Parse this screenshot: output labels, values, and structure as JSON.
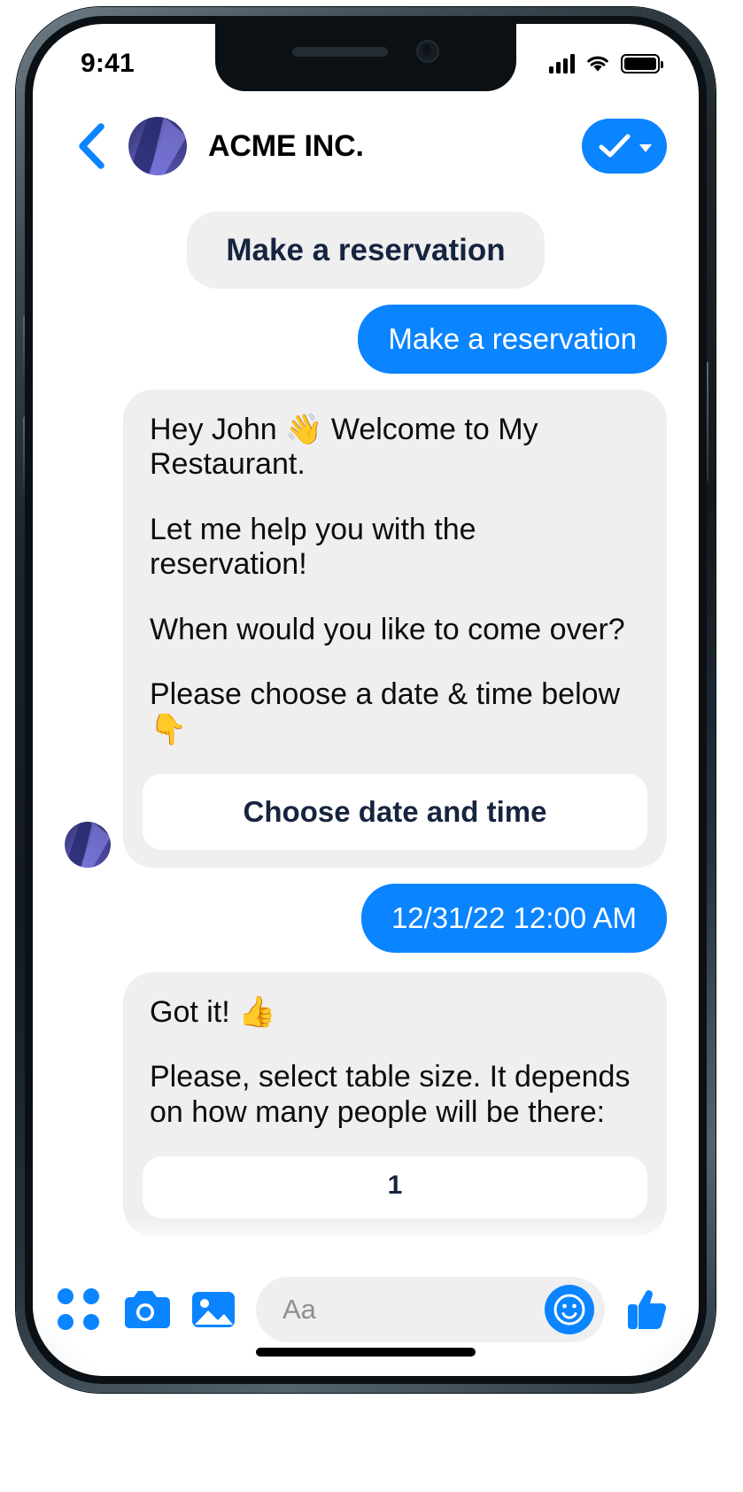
{
  "status_bar": {
    "time": "9:41",
    "signal_icon": "cellular-bars-icon",
    "wifi_icon": "wifi-icon",
    "battery_icon": "battery-full-icon"
  },
  "header": {
    "back_icon": "back-chevron-icon",
    "avatar_icon": "company-avatar",
    "title": "ACME INC.",
    "action_icon": "double-check-icon",
    "action_caret_icon": "caret-down-icon"
  },
  "conversation": [
    {
      "id": "msg-quick-reply-echo",
      "side": "left",
      "type": "quick-reply",
      "text": "Make a reservation"
    },
    {
      "id": "msg-user-1",
      "side": "right",
      "type": "outgoing",
      "text": "Make a reservation"
    },
    {
      "id": "msg-bot-welcome",
      "side": "left",
      "type": "card",
      "paragraphs": [
        "Hey John 👋 Welcome to My Restaurant.",
        "Let me help you with the reservation!",
        "When would you like to come over?",
        "Please choose a date & time below 👇"
      ],
      "button_label": "Choose date and time"
    },
    {
      "id": "msg-user-2",
      "side": "right",
      "type": "outgoing",
      "text": "12/31/22 12:00 AM"
    },
    {
      "id": "msg-bot-table-size",
      "side": "left",
      "type": "card",
      "paragraphs": [
        "Got it! 👍",
        "Please, select table size. It depends on how many people will be there:"
      ],
      "button_label": "1"
    }
  ],
  "composer": {
    "apps_icon": "grid-dots-icon",
    "camera_icon": "camera-icon",
    "gallery_icon": "image-icon",
    "input_placeholder": "Aa",
    "input_value": "",
    "emoji_icon": "smiley-icon",
    "like_icon": "thumbs-up-icon"
  },
  "colors": {
    "accent_blue": "#0a84ff",
    "bubble_gray": "#efeff0",
    "card_button_text": "#16243f",
    "placeholder_gray": "#8e8e93"
  }
}
